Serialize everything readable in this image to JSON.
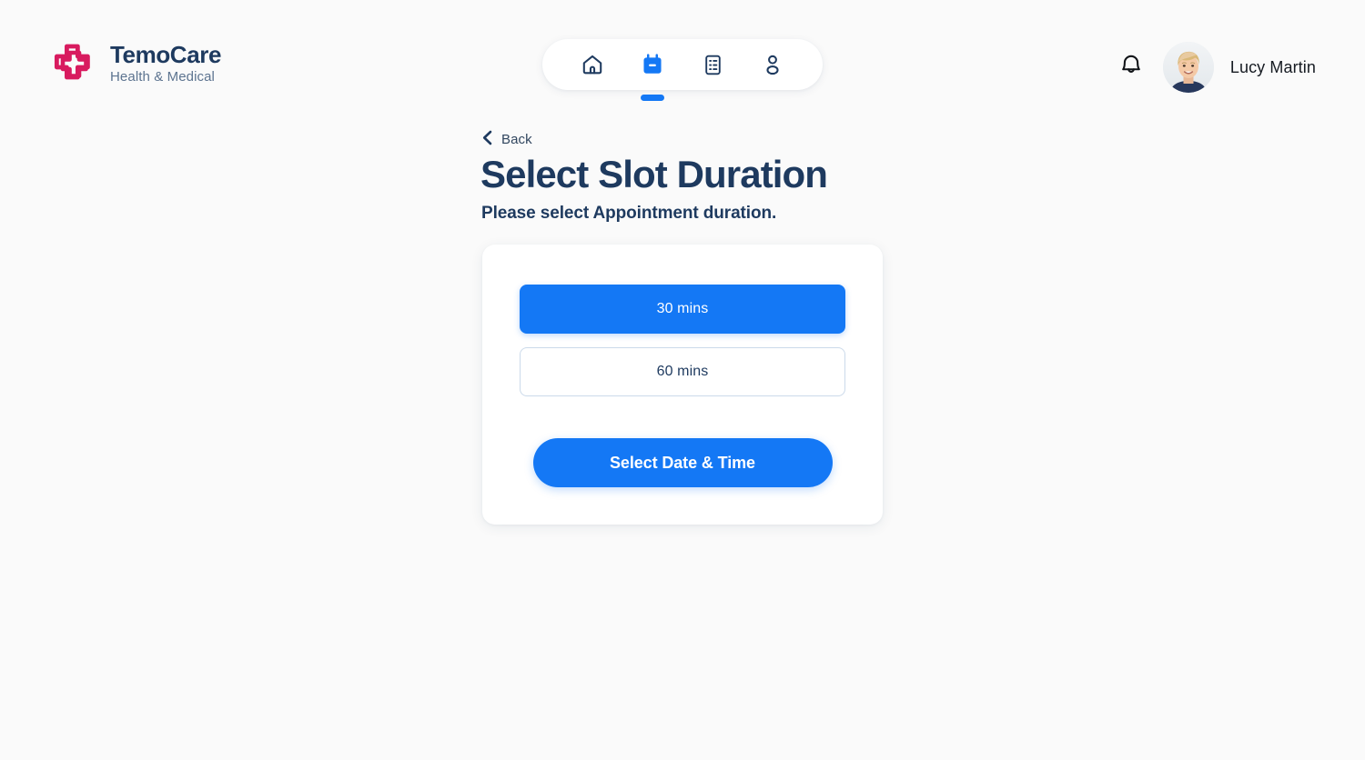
{
  "brand": {
    "name": "TemoCare",
    "tagline": "Health & Medical",
    "logo_icon": "medical-cross-icon",
    "logo_color": "#d81b5f"
  },
  "nav": {
    "items": [
      {
        "icon": "home-icon",
        "name": "home",
        "active": false
      },
      {
        "icon": "calendar-icon",
        "name": "appointments",
        "active": true
      },
      {
        "icon": "records-list-icon",
        "name": "records",
        "active": false
      },
      {
        "icon": "person-icon",
        "name": "profile",
        "active": false
      }
    ],
    "active_color": "#1478f5",
    "inactive_color": "#1e3a5f"
  },
  "user": {
    "notifications_icon": "bell-icon",
    "avatar_icon": "user-avatar-photo",
    "name": "Lucy Martin"
  },
  "main": {
    "back_label": "Back",
    "back_icon": "chevron-left-icon",
    "title": "Select Slot Duration",
    "subtitle": "Please select Appointment duration."
  },
  "card": {
    "durations": [
      {
        "label": "30 mins",
        "selected": true
      },
      {
        "label": "60 mins",
        "selected": false
      }
    ],
    "cta_label": "Select Date & Time"
  },
  "colors": {
    "accent": "#1478f5",
    "navy": "#1e3a5f",
    "brand_pink": "#d81b5f",
    "page_bg": "#fafafa",
    "card_bg": "#ffffff",
    "border": "#cbdaea"
  }
}
